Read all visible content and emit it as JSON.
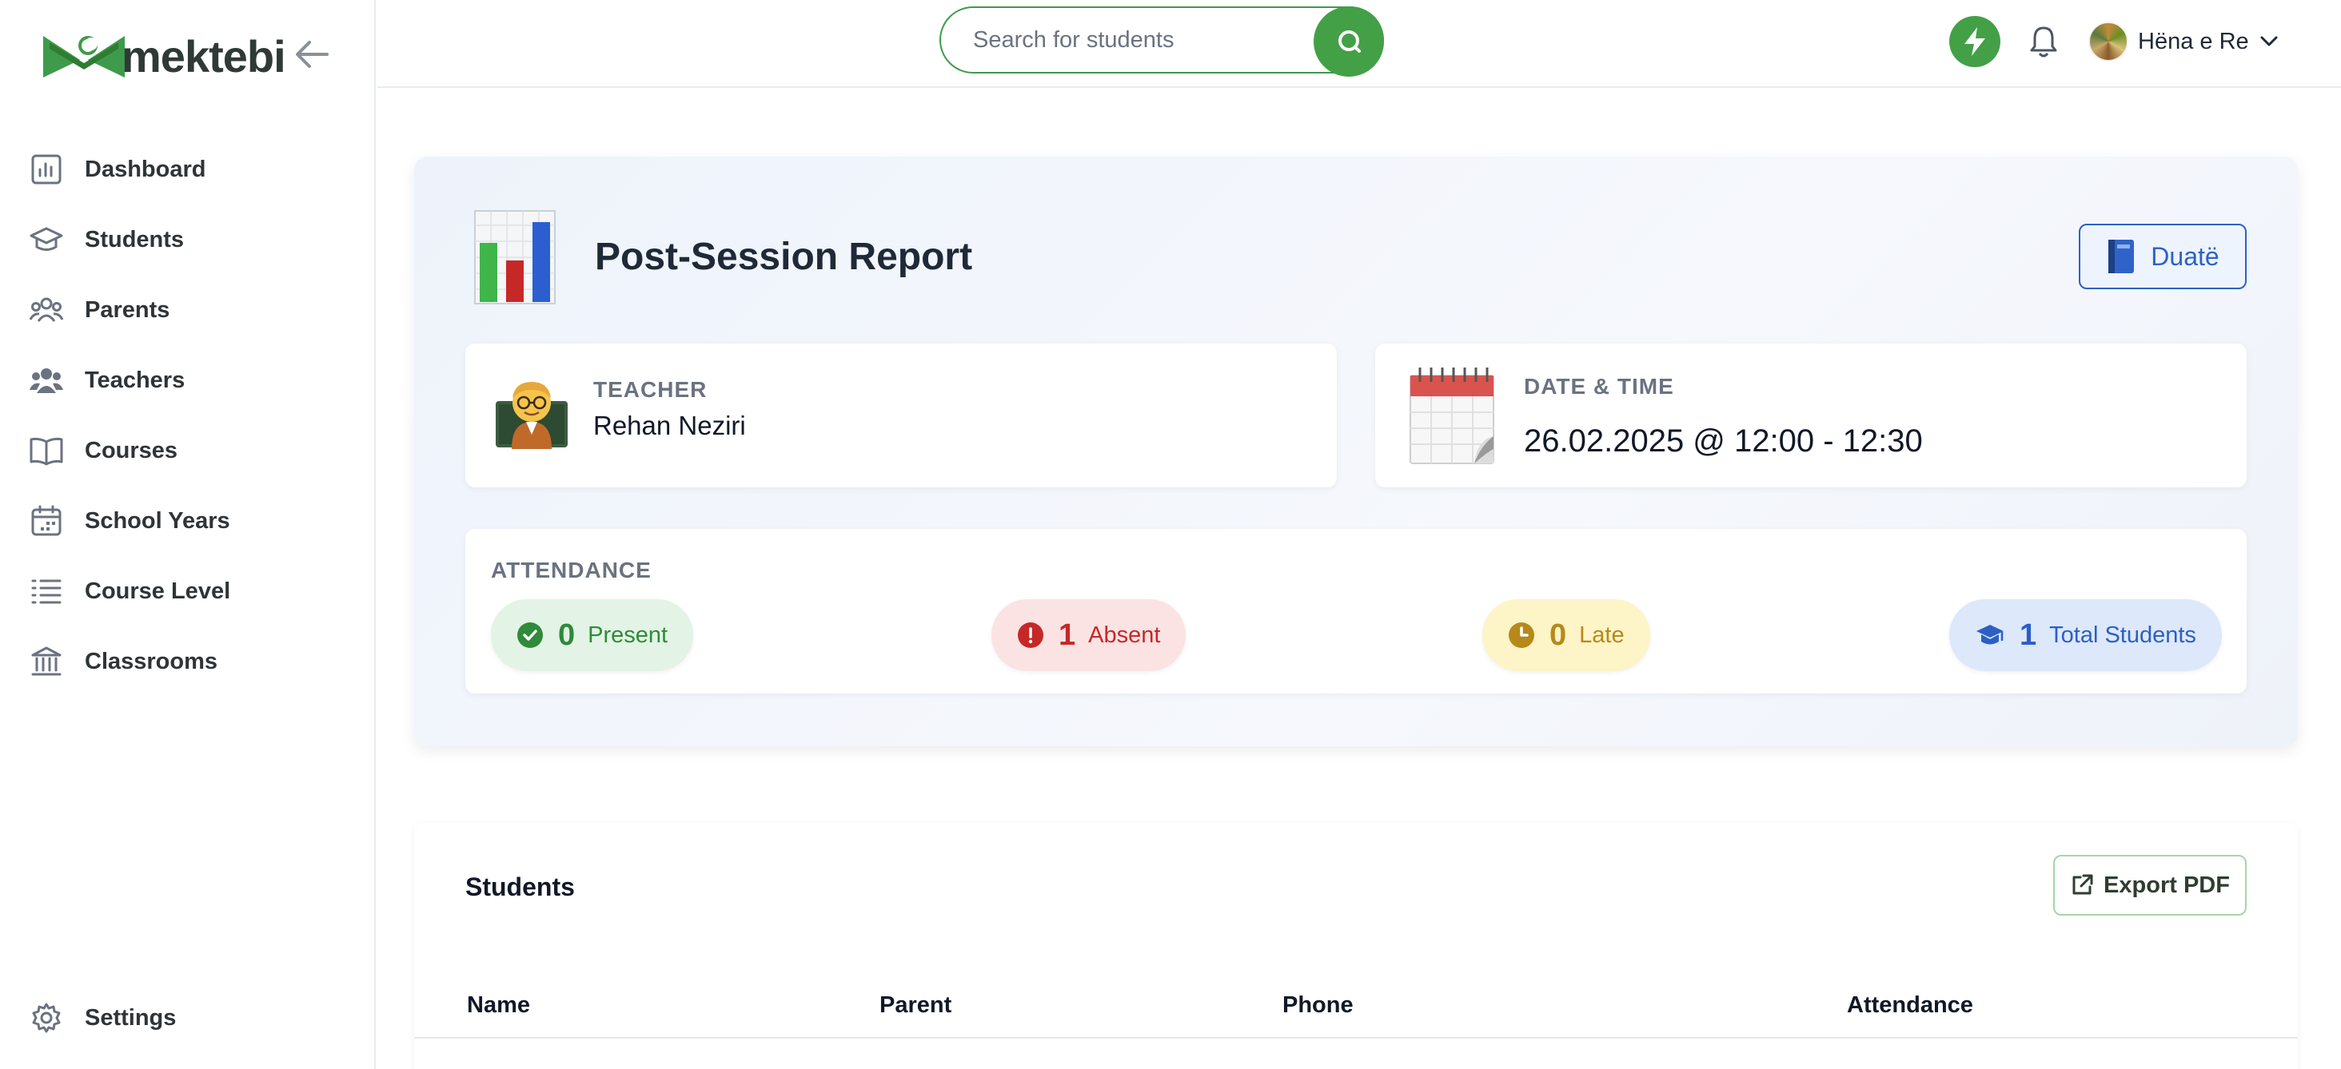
{
  "brand": {
    "name": "mektebi"
  },
  "sidebar": {
    "items": [
      {
        "label": "Dashboard",
        "icon": "bar-chart-icon"
      },
      {
        "label": "Students",
        "icon": "graduation-cap-icon"
      },
      {
        "label": "Parents",
        "icon": "users-group-icon"
      },
      {
        "label": "Teachers",
        "icon": "users-icon"
      },
      {
        "label": "Courses",
        "icon": "book-open-icon"
      },
      {
        "label": "School Years",
        "icon": "calendar-icon"
      },
      {
        "label": "Course Level",
        "icon": "list-icon"
      },
      {
        "label": "Classrooms",
        "icon": "building-columns-icon"
      }
    ],
    "settings": {
      "label": "Settings",
      "icon": "gear-icon"
    }
  },
  "topbar": {
    "search": {
      "placeholder": "Search for students"
    },
    "user": {
      "name": "Hëna e Re"
    }
  },
  "report": {
    "title": "Post-Session Report",
    "prayer_button": "Duatë",
    "teacher": {
      "label": "TEACHER",
      "name": "Rehan Neziri"
    },
    "datetime": {
      "label": "DATE & TIME",
      "value": "26.02.2025 @ 12:00 - 12:30"
    },
    "attendance": {
      "label": "ATTENDANCE",
      "present": {
        "count": "0",
        "label": "Present"
      },
      "absent": {
        "count": "1",
        "label": "Absent"
      },
      "late": {
        "count": "0",
        "label": "Late"
      },
      "total": {
        "count": "1",
        "label": "Total Students"
      }
    }
  },
  "students": {
    "title": "Students",
    "export_label": "Export PDF",
    "columns": [
      "Name",
      "Parent",
      "Phone",
      "Attendance"
    ]
  },
  "colors": {
    "accent_green": "#43a047",
    "present": "#2f8a3a",
    "absent": "#c62828",
    "late": "#b58a1b",
    "total": "#2c5fc4"
  }
}
